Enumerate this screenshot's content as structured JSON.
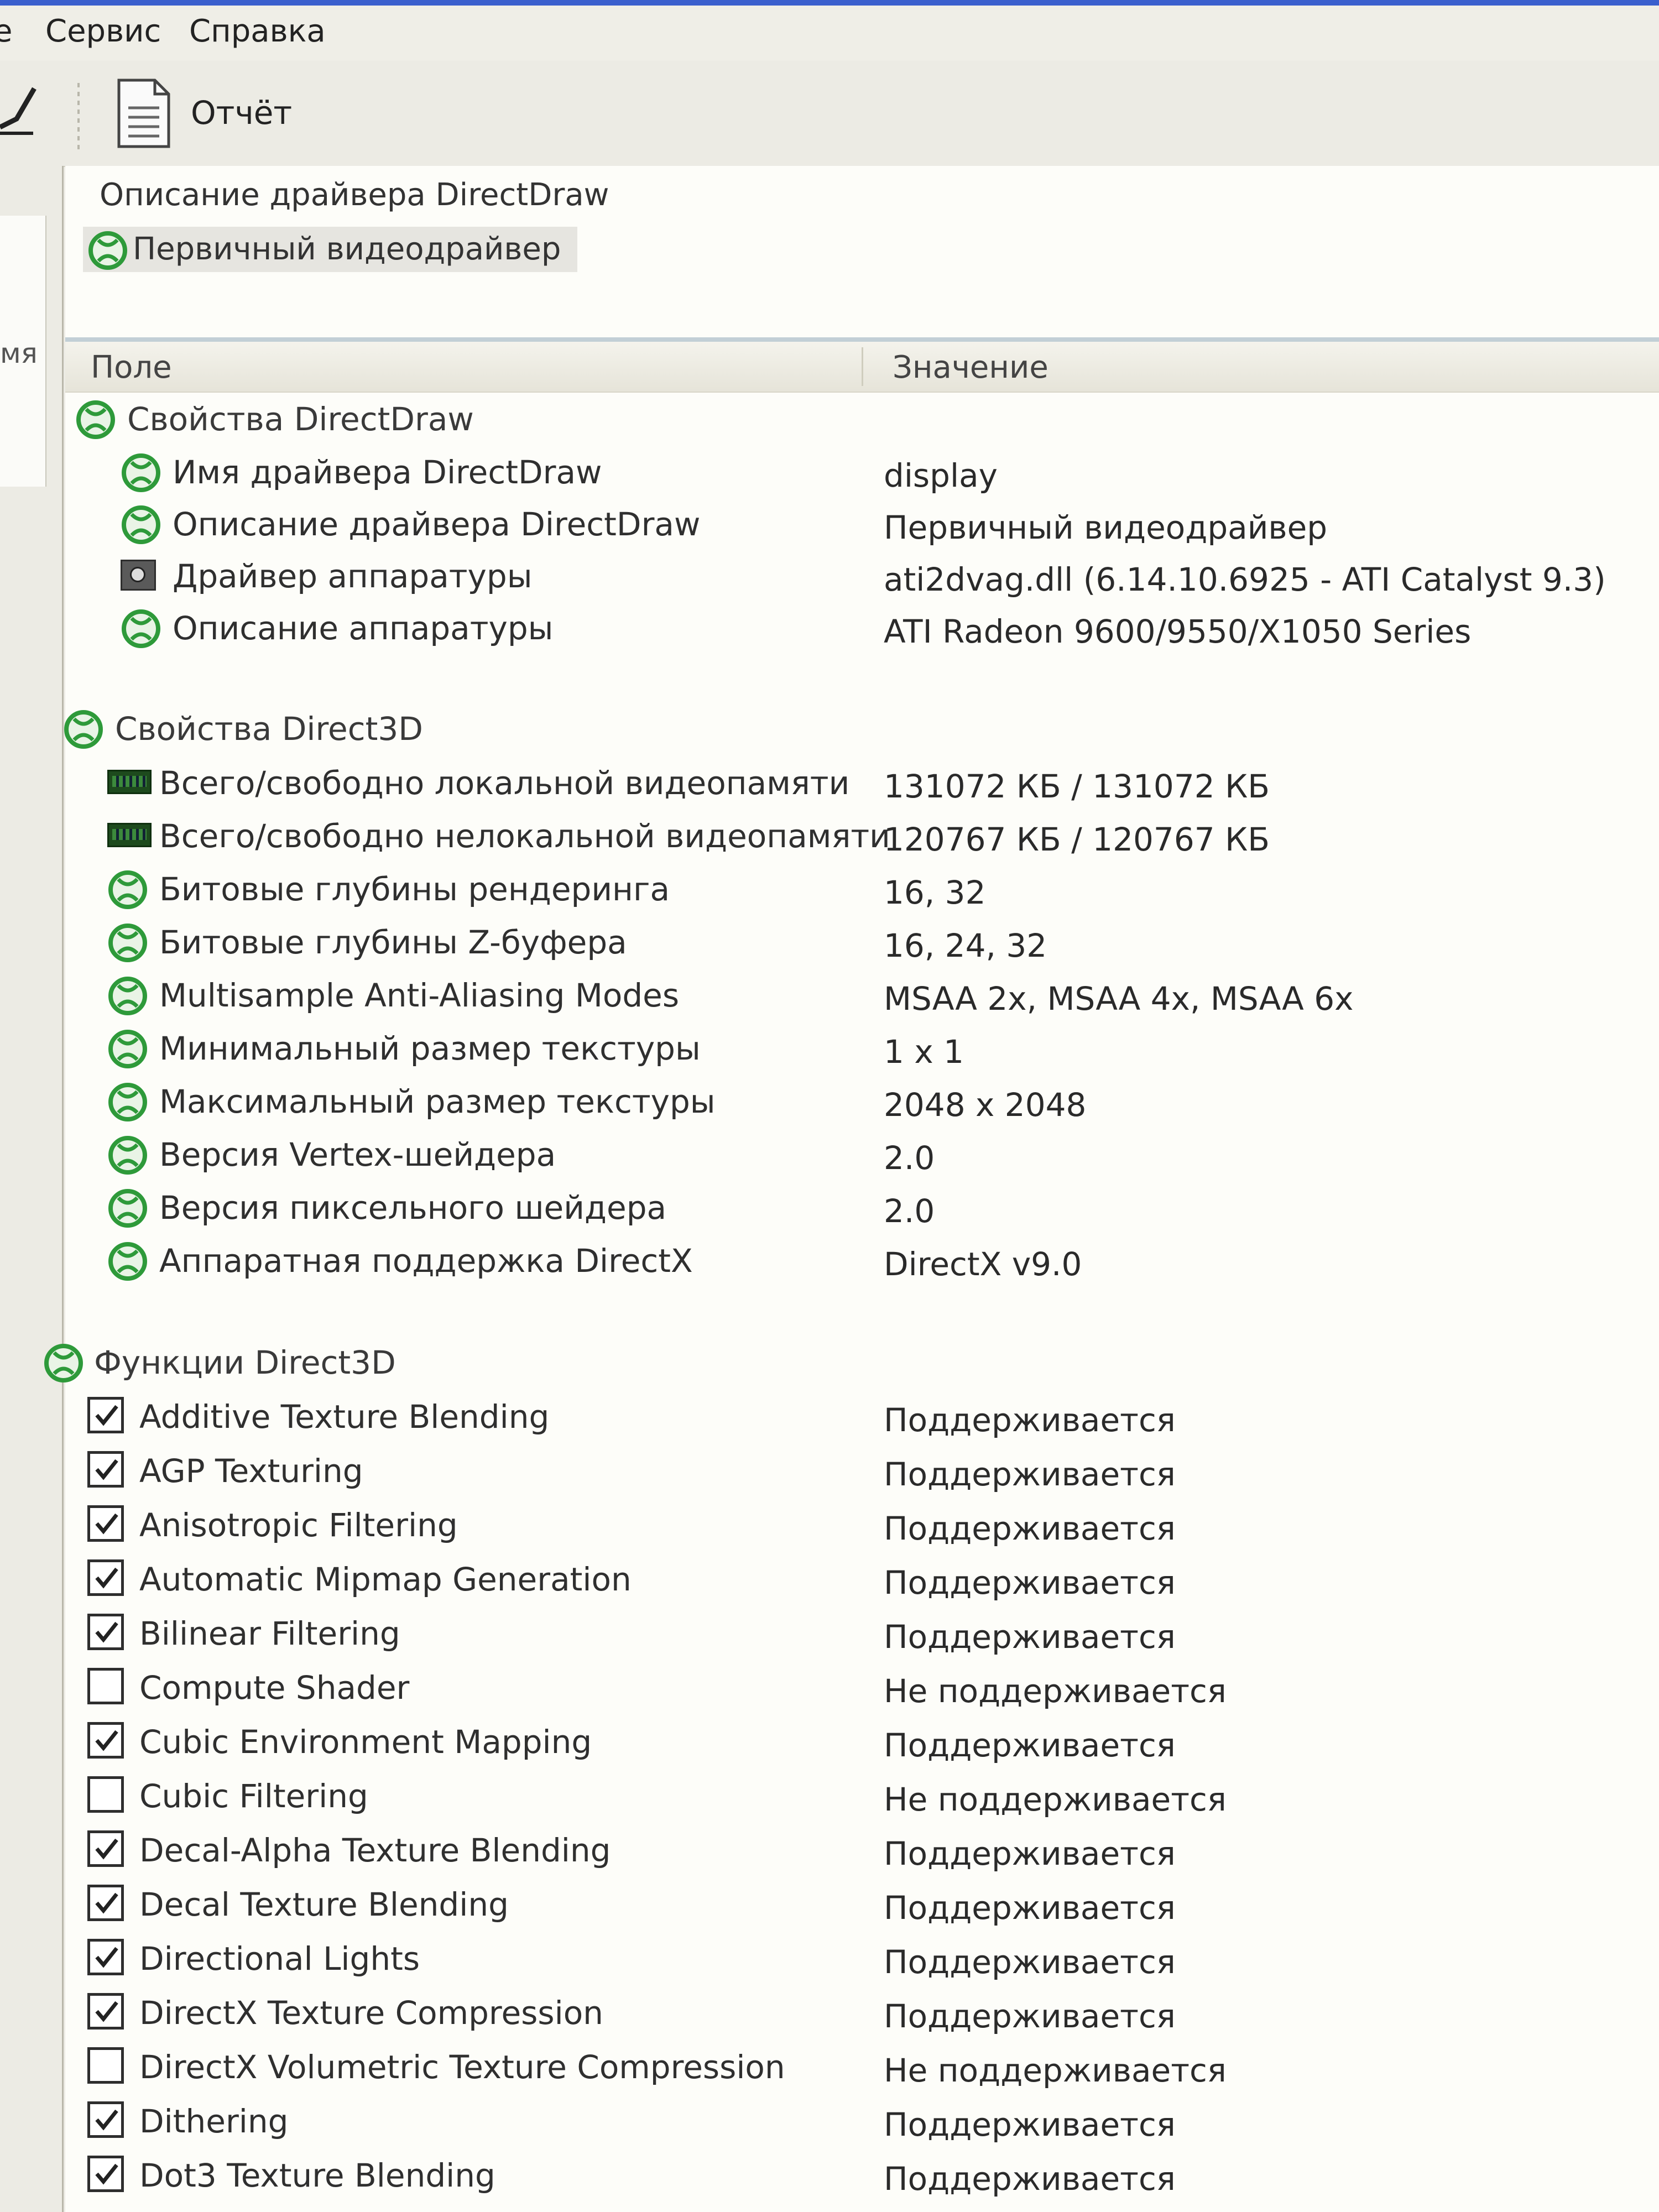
{
  "menu": {
    "partial_left": "е",
    "service": "Сервис",
    "help": "Справка"
  },
  "toolbar": {
    "report_label": "Отчёт"
  },
  "left_pane": {
    "partial_label": "мя"
  },
  "description_panel": {
    "title": "Описание драйвера DirectDraw",
    "selected_item": "Первичный видеодрайвер"
  },
  "table": {
    "headers": {
      "field": "Поле",
      "value": "Значение"
    },
    "directdraw": {
      "group_label": "Свойства DirectDraw",
      "rows": [
        {
          "field": "Имя драйвера DirectDraw",
          "value": "display",
          "icon": "xbox-circle-icon"
        },
        {
          "field": "Описание драйвера DirectDraw",
          "value": "Первичный видеодрайвер",
          "icon": "xbox-circle-icon"
        },
        {
          "field": "Драйвер аппаратуры",
          "value": "ati2dvag.dll (6.14.10.6925 - ATI Catalyst 9.3)",
          "icon": "hardware-icon"
        },
        {
          "field": "Описание аппаратуры",
          "value": "ATI Radeon 9600/9550/X1050 Series",
          "icon": "xbox-circle-icon"
        }
      ]
    },
    "direct3d": {
      "group_label": "Свойства Direct3D",
      "rows": [
        {
          "field": "Всего/свободно локальной видеопамяти",
          "value": "131072 КБ / 131072 КБ",
          "icon": "memory-chip-icon"
        },
        {
          "field": "Всего/свободно нелокальной видеопамяти",
          "value": "120767 КБ / 120767 КБ",
          "icon": "memory-chip-icon"
        },
        {
          "field": "Битовые глубины рендеринга",
          "value": "16, 32",
          "icon": "xbox-circle-icon"
        },
        {
          "field": "Битовые глубины Z-буфера",
          "value": "16, 24, 32",
          "icon": "xbox-circle-icon"
        },
        {
          "field": "Multisample Anti-Aliasing Modes",
          "value": "MSAA 2x, MSAA 4x, MSAA 6x",
          "icon": "xbox-circle-icon"
        },
        {
          "field": "Минимальный размер текстуры",
          "value": "1 x 1",
          "icon": "xbox-circle-icon"
        },
        {
          "field": "Максимальный размер текстуры",
          "value": "2048 x 2048",
          "icon": "xbox-circle-icon"
        },
        {
          "field": "Версия Vertex-шейдера",
          "value": "2.0",
          "icon": "xbox-circle-icon"
        },
        {
          "field": "Версия пиксельного шейдера",
          "value": "2.0",
          "icon": "xbox-circle-icon"
        },
        {
          "field": "Аппаратная поддержка DirectX",
          "value": "DirectX v9.0",
          "icon": "xbox-circle-icon"
        }
      ]
    },
    "functions": {
      "group_label": "Функции Direct3D",
      "rows": [
        {
          "field": "Additive Texture Blending",
          "value": "Поддерживается",
          "checked": true
        },
        {
          "field": "AGP Texturing",
          "value": "Поддерживается",
          "checked": true
        },
        {
          "field": "Anisotropic Filtering",
          "value": "Поддерживается",
          "checked": true
        },
        {
          "field": "Automatic Mipmap Generation",
          "value": "Поддерживается",
          "checked": true
        },
        {
          "field": "Bilinear Filtering",
          "value": "Поддерживается",
          "checked": true
        },
        {
          "field": "Compute Shader",
          "value": "Не поддерживается",
          "checked": false
        },
        {
          "field": "Cubic Environment Mapping",
          "value": "Поддерживается",
          "checked": true
        },
        {
          "field": "Cubic Filtering",
          "value": "Не поддерживается",
          "checked": false
        },
        {
          "field": "Decal-Alpha Texture Blending",
          "value": "Поддерживается",
          "checked": true
        },
        {
          "field": "Decal Texture Blending",
          "value": "Поддерживается",
          "checked": true
        },
        {
          "field": "Directional Lights",
          "value": "Поддерживается",
          "checked": true
        },
        {
          "field": "DirectX Texture Compression",
          "value": "Поддерживается",
          "checked": true
        },
        {
          "field": "DirectX Volumetric Texture Compression",
          "value": "Не поддерживается",
          "checked": false
        },
        {
          "field": "Dithering",
          "value": "Поддерживается",
          "checked": true
        },
        {
          "field": "Dot3 Texture Blending",
          "value": "Поддерживается",
          "checked": true
        }
      ]
    }
  },
  "colors": {
    "icon_green": "#2e9a3a",
    "header_bg": "#ebe9de",
    "panel_bg": "#fdfdf9"
  }
}
